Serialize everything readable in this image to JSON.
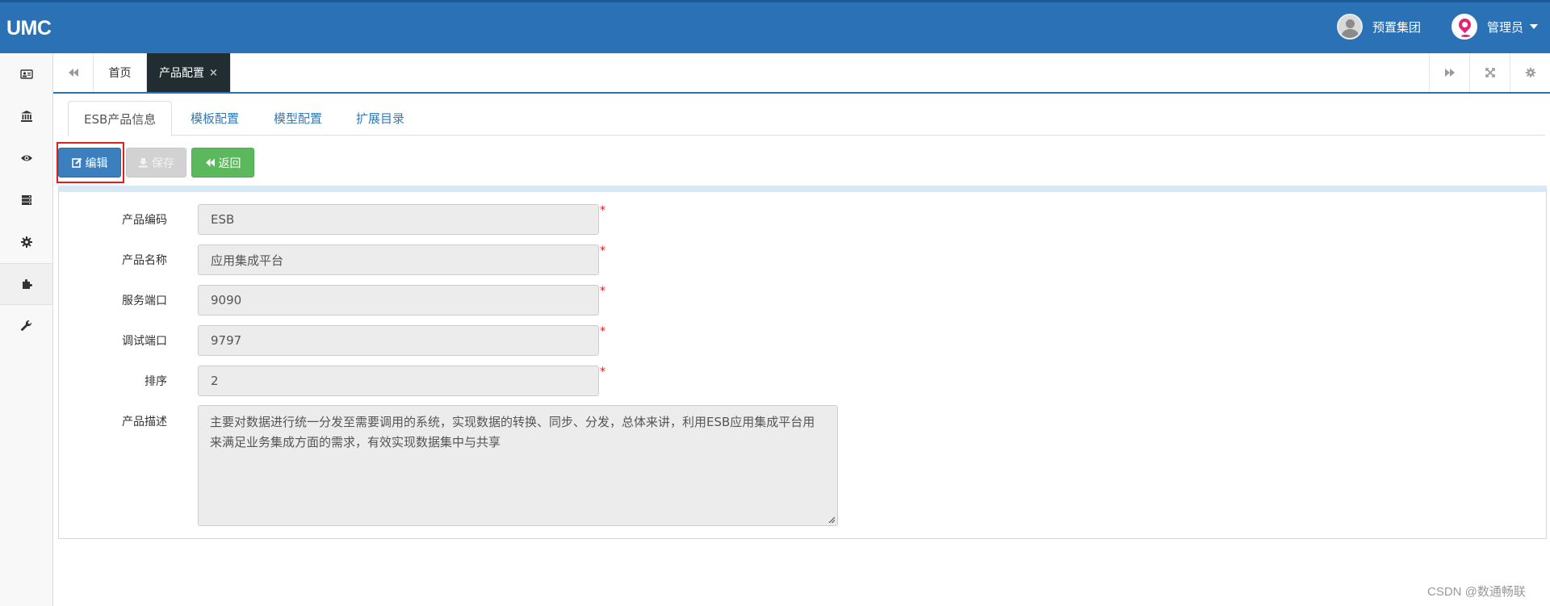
{
  "app": {
    "brand": "UMC"
  },
  "header": {
    "org_name": "预置集团",
    "user_name": "管理员"
  },
  "sidebar": {
    "items": [
      {
        "icon": "id-card-icon"
      },
      {
        "icon": "bank-icon"
      },
      {
        "icon": "eye-icon"
      },
      {
        "icon": "server-icon"
      },
      {
        "icon": "gear-icon"
      },
      {
        "icon": "puzzle-icon",
        "active": true
      },
      {
        "icon": "wrench-icon"
      }
    ]
  },
  "tabs": {
    "home": "首页",
    "current": "产品配置",
    "close": "×"
  },
  "inner_tabs": [
    "ESB产品信息",
    "模板配置",
    "模型配置",
    "扩展目录"
  ],
  "toolbar": {
    "edit_label": "编辑",
    "save_label": "保存",
    "back_label": "返回"
  },
  "form": {
    "required_mark": "*",
    "fields": [
      {
        "label": "产品编码",
        "value": "ESB"
      },
      {
        "label": "产品名称",
        "value": "应用集成平台"
      },
      {
        "label": "服务端口",
        "value": "9090"
      },
      {
        "label": "调试端口",
        "value": "9797"
      },
      {
        "label": "排序",
        "value": "2"
      }
    ],
    "description": {
      "label": "产品描述",
      "value": "主要对数据进行统一分发至需要调用的系统，实现数据的转换、同步、分发，总体来讲，利用ESB应用集成平台用来满足业务集成方面的需求，有效实现数据集中与共享"
    }
  },
  "watermark": "CSDN @数通畅联",
  "colors": {
    "header_bg": "#2a71b6",
    "edit_button": "#3c7fbf",
    "back_button": "#5cb85c",
    "highlight": "#e02020",
    "active_tab": "#222d32"
  }
}
